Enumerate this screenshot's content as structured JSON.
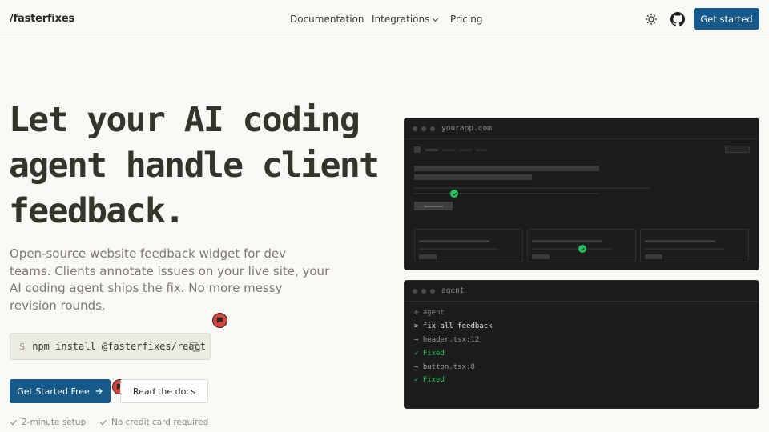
{
  "nav": {
    "logo": "/fasterfixes",
    "links": [
      "Documentation",
      "Integrations",
      "Pricing"
    ],
    "cta": "Get started",
    "theme_icon": "sun-icon",
    "github_icon": "github-icon"
  },
  "hero": {
    "title_lines": [
      "Let your AI coding",
      "agent handle client",
      "feedback."
    ],
    "subtitle": "Open-source website feedback widget for dev teams. Clients annotate issues on your live site, your AI coding agent ships the fix. No more messy revision rounds."
  },
  "install": {
    "prompt": "$",
    "command": "npm install @fasterfixes/react",
    "copy_icon": "copy-icon"
  },
  "buttons": {
    "primary": "Get Started Free",
    "secondary": "Read the docs"
  },
  "checks": [
    "2-minute setup",
    "No credit card required"
  ],
  "browser_window": {
    "title": "yourapp.com"
  },
  "agent_window": {
    "title": "agent",
    "lines": [
      {
        "icon": "sparkle-icon",
        "text": "agent",
        "style": "muted"
      },
      {
        "text": "> fix all feedback",
        "style": "cmd"
      },
      {
        "text": "→ header.tsx:12",
        "style": "file"
      },
      {
        "text": "✓ Fixed",
        "style": "ok"
      },
      {
        "text": "→ button.tsx:8",
        "style": "file"
      },
      {
        "text": "✓ Fixed",
        "style": "ok"
      }
    ]
  },
  "colors": {
    "background": "#f9f8f4",
    "primary": "#165a8c",
    "pin": "#d5433f",
    "success": "#22c55e",
    "dark": "#1c1c1c"
  }
}
